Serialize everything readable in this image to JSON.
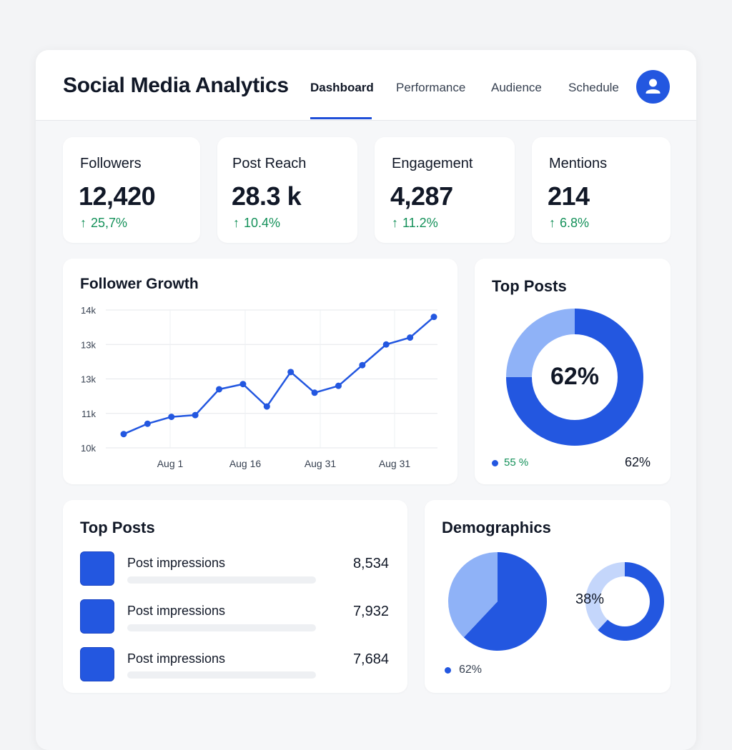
{
  "header": {
    "title": "Social Media Analytics",
    "tabs": [
      {
        "label": "Dashboard",
        "active": true
      },
      {
        "label": "Performance",
        "active": false
      },
      {
        "label": "Audience",
        "active": false
      },
      {
        "label": "Schedule",
        "active": false
      }
    ],
    "avatar_icon": "user-icon"
  },
  "stats": [
    {
      "label": "Followers",
      "value": "12,420",
      "change": "25,7%",
      "trend_icon": "arrow-up-icon"
    },
    {
      "label": "Post Reach",
      "value": "28.3 k",
      "change": "10.4%",
      "trend_icon": "arrow-up-icon"
    },
    {
      "label": "Engagement",
      "value": "4,287",
      "change": "11.2%",
      "trend_icon": "arrow-up-icon"
    },
    {
      "label": "Mentions",
      "value": "214",
      "change": "6.8%",
      "trend_icon": "arrow-up-icon"
    }
  ],
  "colors": {
    "accent": "#2357e0",
    "accent_light": "#8fb2f7",
    "positive": "#15915a"
  },
  "follower_growth": {
    "title": "Follower Growth",
    "chart_data": {
      "type": "line",
      "y_tick_labels": [
        "14k",
        "13k",
        "13k",
        "11k",
        "10k"
      ],
      "x_tick_labels": [
        "Aug 1",
        "Aug 16",
        "Aug 31",
        "Aug 31"
      ],
      "ylim": [
        10,
        14
      ],
      "grid": true,
      "values": [
        10.4,
        10.7,
        10.9,
        10.95,
        11.7,
        11.85,
        11.2,
        12.2,
        11.6,
        11.8,
        12.4,
        13.0,
        13.2,
        13.8
      ]
    }
  },
  "top_posts_donut": {
    "title": "Top Posts",
    "center_label": "62%",
    "legend_left": "55 %",
    "legend_right": "62%",
    "chart_data": {
      "type": "pie",
      "donut": true,
      "slices": [
        {
          "value": 75,
          "color": "#2357e0"
        },
        {
          "value": 25,
          "color": "#8fb2f7"
        }
      ]
    }
  },
  "top_posts_list": {
    "title": "Top Posts",
    "items": [
      {
        "label": "Post impressions",
        "value": "8,534"
      },
      {
        "label": "Post impressions",
        "value": "7,932"
      },
      {
        "label": "Post impressions",
        "value": "7,684"
      }
    ]
  },
  "demographics": {
    "title": "Demographics",
    "ring_label": "38%",
    "legend": "62%",
    "chart_data": [
      {
        "type": "pie",
        "slices": [
          {
            "value": 62,
            "color": "#2357e0"
          },
          {
            "value": 38,
            "color": "#8fb2f7"
          }
        ]
      },
      {
        "type": "pie",
        "donut": true,
        "slices": [
          {
            "value": 62,
            "color": "#2357e0"
          },
          {
            "value": 38,
            "color": "#c4d6fb"
          }
        ]
      }
    ]
  }
}
